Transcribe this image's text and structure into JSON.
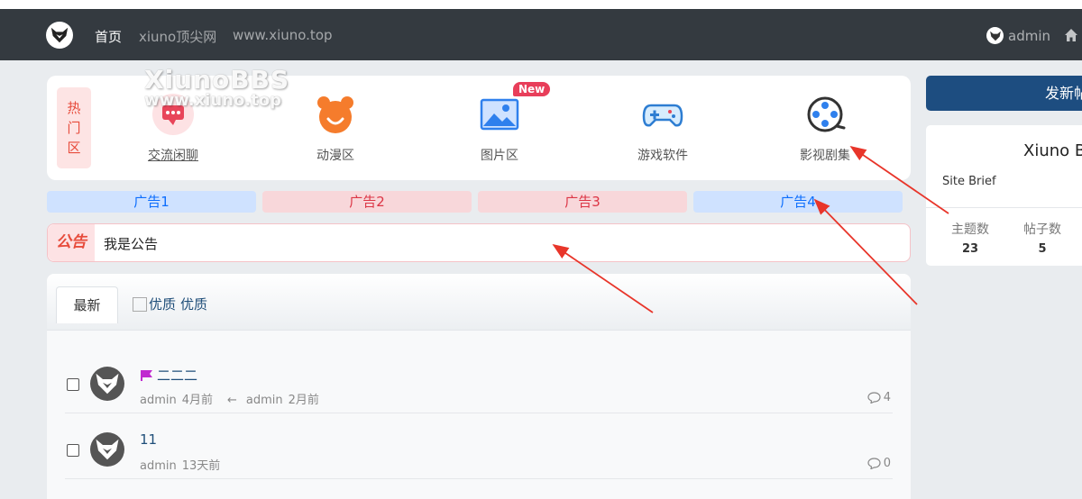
{
  "navbar": {
    "home": "首页",
    "site_name": "xiuno顶尖网",
    "site_url": "www.xiuno.top",
    "user": "admin"
  },
  "watermark": {
    "line1": "XiunoBBS",
    "line2": "www.xiuno.top"
  },
  "forums": {
    "hot_label": [
      "热",
      "门",
      "区"
    ],
    "items": [
      {
        "label": "交流闲聊",
        "icon": "chat-bubble-icon"
      },
      {
        "label": "动漫区",
        "icon": "bear-face-icon"
      },
      {
        "label": "图片区",
        "icon": "picture-icon"
      },
      {
        "label": "游戏软件",
        "icon": "gamepad-icon"
      },
      {
        "label": "影视剧集",
        "icon": "film-reel-icon"
      }
    ],
    "new_badge": "New"
  },
  "ads": [
    "广告1",
    "广告2",
    "广告3",
    "广告4"
  ],
  "notice": {
    "tag": "公告",
    "text": "我是公告"
  },
  "tabs": {
    "latest": "最新",
    "quality_alt": "优质",
    "quality": "优质"
  },
  "threads": [
    {
      "title": "二二二",
      "author": "admin",
      "time": "4月前",
      "arrow": "←",
      "last_author": "admin",
      "last_time": "2月前",
      "replies": "4"
    },
    {
      "title": "11",
      "author": "admin",
      "time": "13天前",
      "replies": "0"
    }
  ],
  "sidebar": {
    "new_post": "发新帖",
    "site_title": "Xiuno B",
    "site_brief": "Site Brief",
    "stats": [
      {
        "label": "主题数",
        "value": "23"
      },
      {
        "label": "帖子数",
        "value": "5"
      }
    ]
  },
  "colors": {
    "navbar": "#343a40",
    "primary": "#1d4d80",
    "danger": "#e74c3c",
    "arrow": "#e8352a"
  }
}
